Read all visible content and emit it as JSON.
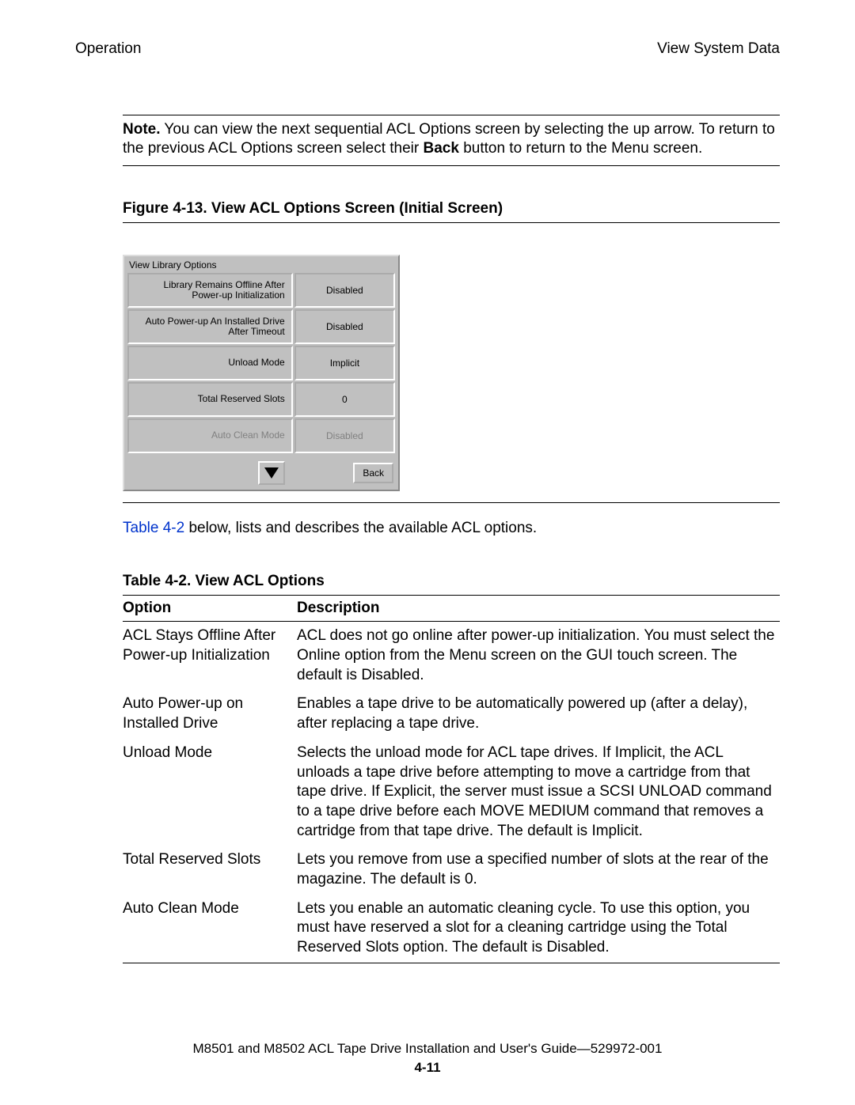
{
  "header": {
    "left": "Operation",
    "right": "View System Data"
  },
  "note": {
    "label": "Note.",
    "text_before_bold": " You can view the next sequential ACL Options screen by selecting the up arrow. To return to the previous ACL Options screen select their ",
    "bold_word": "Back",
    "text_after_bold": " button to return to the Menu screen."
  },
  "figure": {
    "caption": "Figure 4-13.  View ACL Options Screen (Initial Screen)"
  },
  "ui": {
    "title": "View Library Options",
    "rows": [
      {
        "label": "Library Remains Offline After Power-up Initialization",
        "value": "Disabled",
        "dim": false
      },
      {
        "label": "Auto Power-up An Installed Drive After Timeout",
        "value": "Disabled",
        "dim": false
      },
      {
        "label": "Unload Mode",
        "value": "Implicit",
        "dim": false
      },
      {
        "label": "Total Reserved Slots",
        "value": "0",
        "dim": false
      },
      {
        "label": "Auto Clean Mode",
        "value": "Disabled",
        "dim": true
      }
    ],
    "back_label": "Back"
  },
  "intro": {
    "link_text": "Table 4-2",
    "after_link": " below, lists and describes the available ACL options."
  },
  "table": {
    "caption": "Table 4-2.  View ACL Options",
    "headers": {
      "option": "Option",
      "description": "Description"
    },
    "rows": [
      {
        "option": "ACL Stays Offline After Power-up Initialization",
        "description": "ACL does not go online after power-up initialization. You must select the Online option from the Menu screen on the GUI touch screen. The default is Disabled."
      },
      {
        "option": "Auto Power-up on Installed Drive",
        "description": "Enables a tape drive to be automatically powered up (after a delay), after replacing a tape drive."
      },
      {
        "option": "Unload Mode",
        "description": "Selects the unload mode for ACL tape drives. If Implicit, the ACL unloads a tape drive before attempting to move a cartridge from that tape drive. If Explicit, the server must issue a SCSI UNLOAD command to a tape drive before each MOVE MEDIUM command that removes a cartridge from that tape drive. The default is Implicit."
      },
      {
        "option": "Total Reserved Slots",
        "description": "Lets you remove from use a specified number of slots at the rear of the magazine. The default is 0."
      },
      {
        "option": "Auto Clean Mode",
        "description": "Lets you enable an automatic cleaning cycle. To use this option, you must have reserved a slot for a cleaning cartridge using the Total Reserved Slots option. The default is Disabled."
      }
    ]
  },
  "footer": {
    "line": "M8501 and M8502 ACL Tape Drive Installation and User's Guide—529972-001",
    "page": "4-11"
  }
}
